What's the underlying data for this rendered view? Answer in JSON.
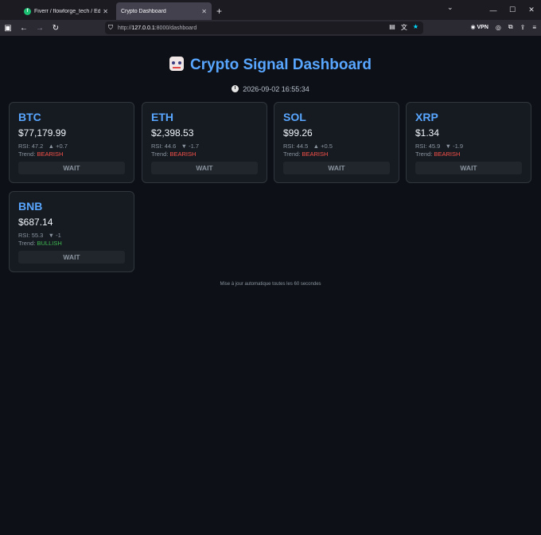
{
  "browser": {
    "tabs": [
      {
        "title": "Fiverr / flowforge_tech / Edit Gi",
        "active": false
      },
      {
        "title": "Crypto Dashboard",
        "active": true
      }
    ],
    "url_prefix": "http://",
    "url_host": "127.0.0.1",
    "url_path": ":8000/dashboard",
    "vpn_label": "VPN"
  },
  "dashboard": {
    "title": "Crypto Signal Dashboard",
    "timestamp": "2026-09-02 16:55:34",
    "footer": "Mise à jour automatique toutes les 60 secondes"
  },
  "coins": [
    {
      "symbol": "BTC",
      "price": "$77,179.99",
      "rsi_label": "RSI:",
      "rsi": "47.2",
      "change": "▲ +0.7",
      "trend_label": "Trend:",
      "trend": "BEARISH",
      "signal": "WAIT"
    },
    {
      "symbol": "ETH",
      "price": "$2,398.53",
      "rsi_label": "RSI:",
      "rsi": "44.6",
      "change": "▼ -1.7",
      "trend_label": "Trend:",
      "trend": "BEARISH",
      "signal": "WAIT"
    },
    {
      "symbol": "SOL",
      "price": "$99.26",
      "rsi_label": "RSI:",
      "rsi": "44.5",
      "change": "▲ +0.5",
      "trend_label": "Trend:",
      "trend": "BEARISH",
      "signal": "WAIT"
    },
    {
      "symbol": "XRP",
      "price": "$1.34",
      "rsi_label": "RSI:",
      "rsi": "45.9",
      "change": "▼ -1.9",
      "trend_label": "Trend:",
      "trend": "BEARISH",
      "signal": "WAIT"
    },
    {
      "symbol": "BNB",
      "price": "$687.14",
      "rsi_label": "RSI:",
      "rsi": "55.3",
      "change": "▼ -1",
      "trend_label": "Trend:",
      "trend": "BULLISH",
      "signal": "WAIT"
    }
  ],
  "colors": {
    "accent": "#58a6ff",
    "bearish": "#f85149",
    "bullish": "#3fb950",
    "background": "#0d1117"
  }
}
